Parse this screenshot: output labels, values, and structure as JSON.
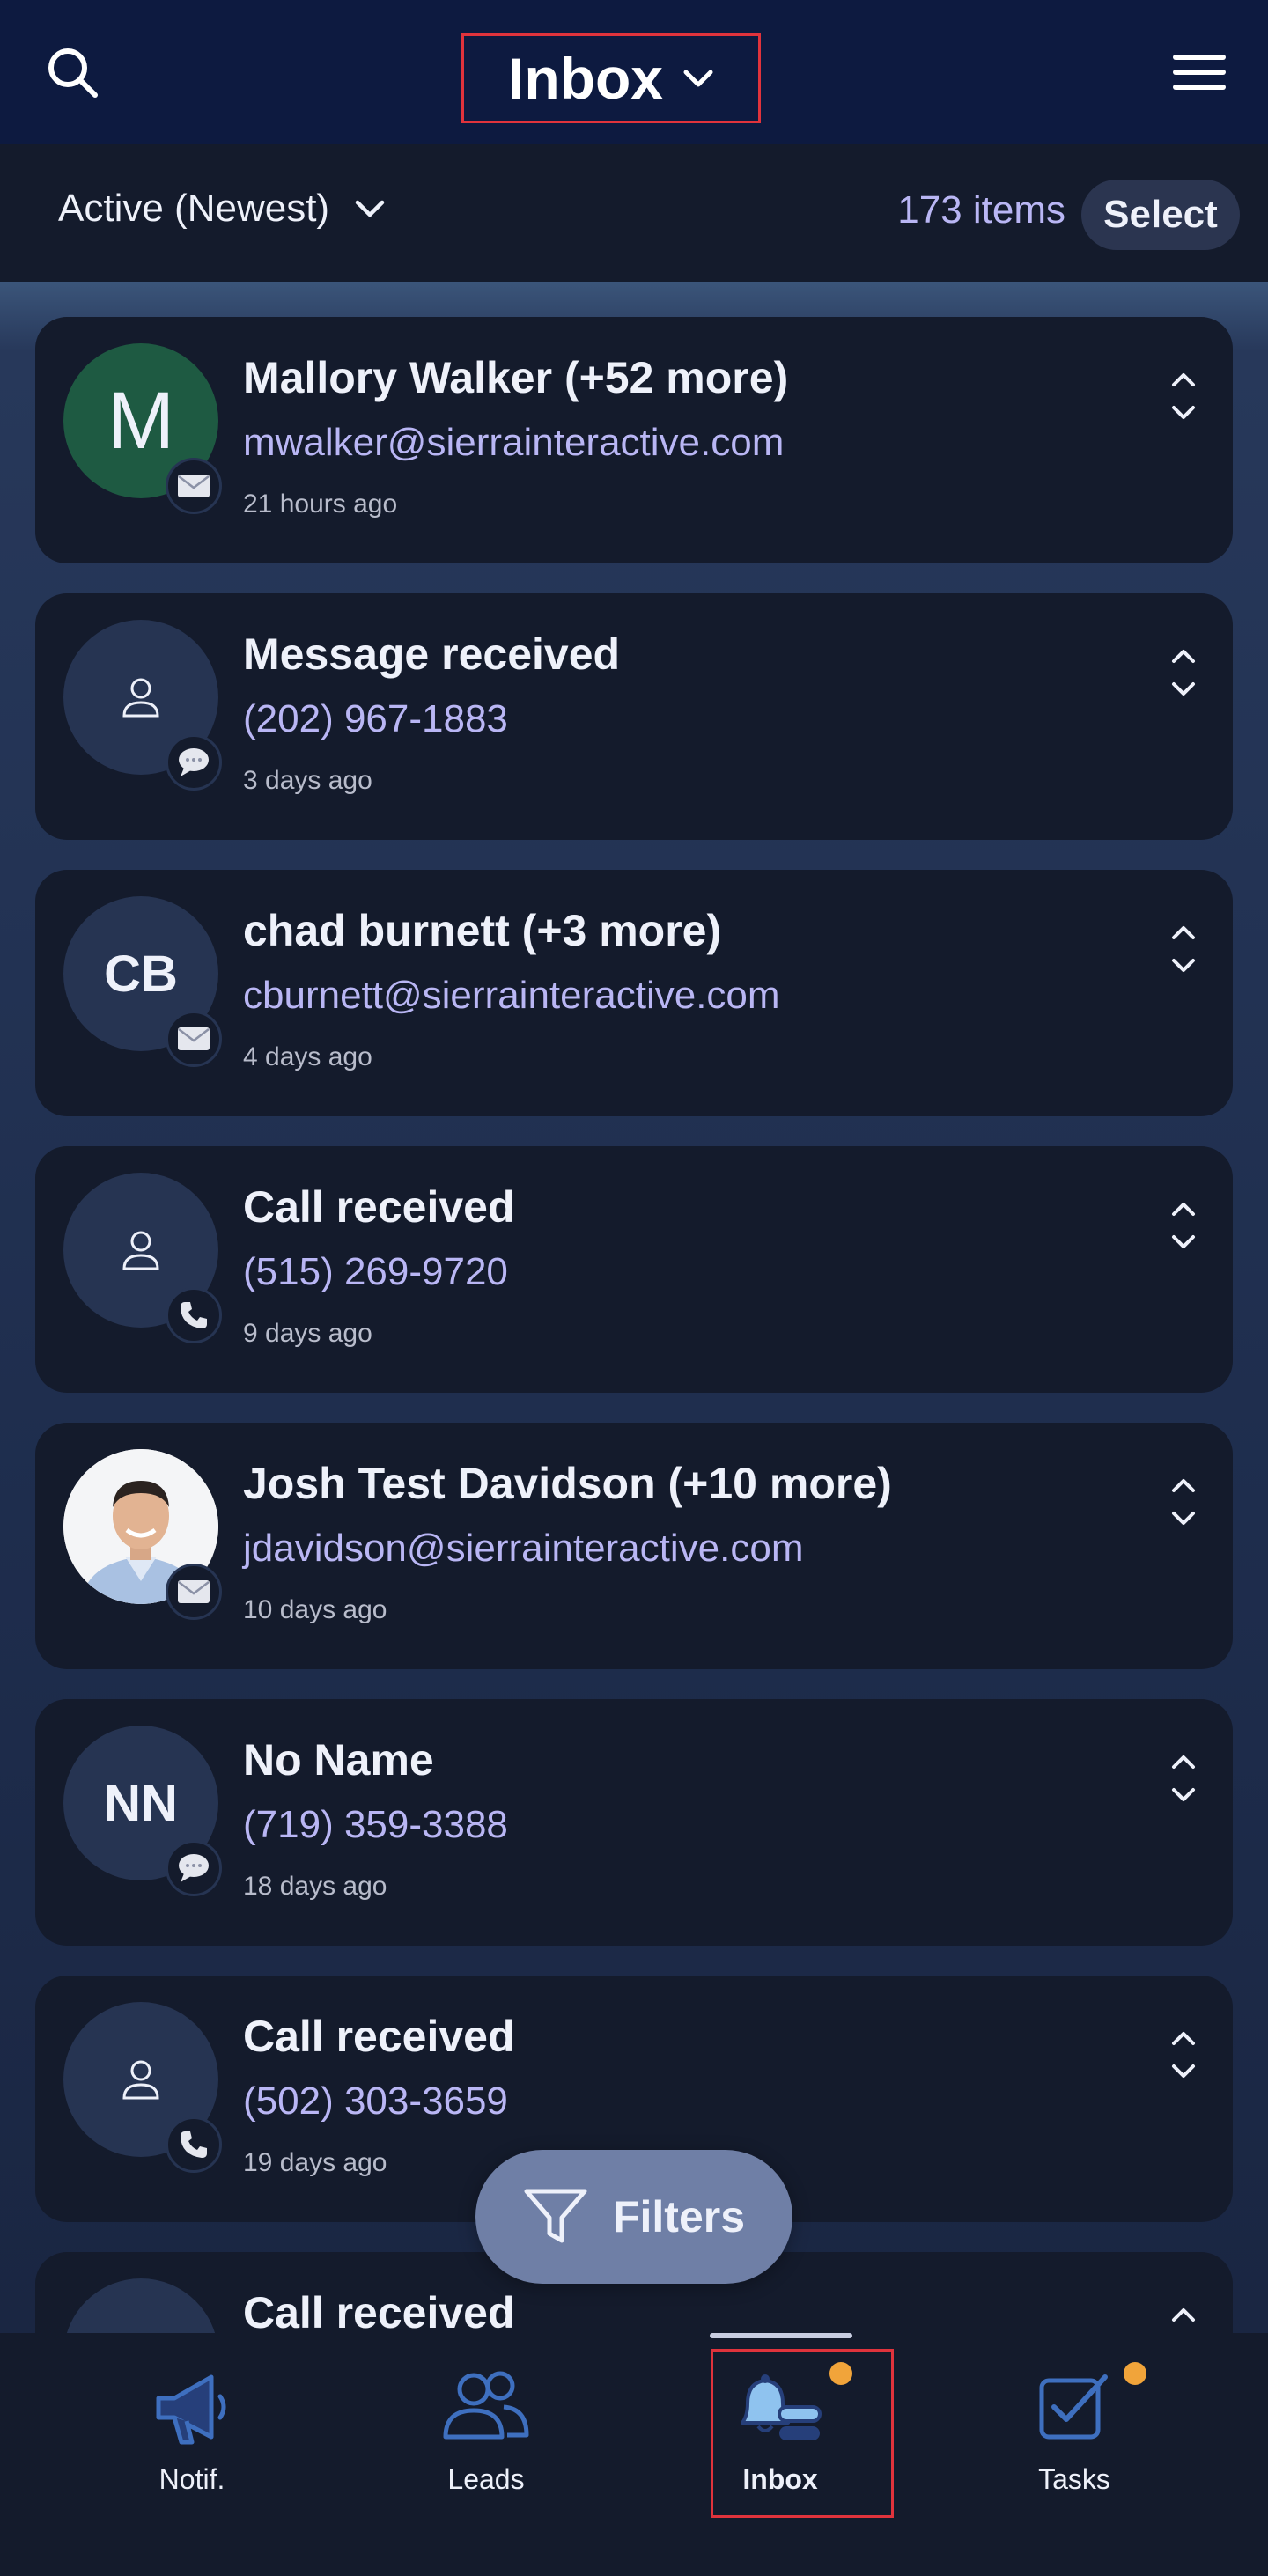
{
  "header": {
    "title": "Inbox"
  },
  "subbar": {
    "sort_label": "Active (Newest)",
    "count": "173 items",
    "select_label": "Select"
  },
  "items": [
    {
      "title": "Mallory Walker (+52 more)",
      "subtitle": "mwalker@sierrainteractive.com",
      "time": "21 hours ago",
      "avatar": "M",
      "channel": "envelope-icon"
    },
    {
      "title": "Message received",
      "subtitle": "(202) 967-1883",
      "time": "3 days ago",
      "avatar": "",
      "channel": "chat-icon"
    },
    {
      "title": "chad burnett (+3 more)",
      "subtitle": "cburnett@sierrainteractive.com",
      "time": "4 days ago",
      "avatar": "CB",
      "channel": "envelope-icon"
    },
    {
      "title": "Call received",
      "subtitle": "(515) 269-9720",
      "time": "9 days ago",
      "avatar": "",
      "channel": "phone-icon"
    },
    {
      "title": "Josh Test Davidson (+10 more)",
      "subtitle": "jdavidson@sierrainteractive.com",
      "time": "10 days ago",
      "avatar": "",
      "channel": "envelope-icon"
    },
    {
      "title": "No Name",
      "subtitle": "(719) 359-3388",
      "time": "18 days ago",
      "avatar": "NN",
      "channel": "chat-icon"
    },
    {
      "title": "Call received",
      "subtitle": "(502) 303-3659",
      "time": "19 days ago",
      "avatar": "",
      "channel": "phone-icon"
    },
    {
      "title": "Call received",
      "subtitle": "",
      "time": "",
      "avatar": "",
      "channel": ""
    }
  ],
  "filters": {
    "label": "Filters"
  },
  "nav": [
    {
      "label": "Notif.",
      "icon": "megaphone-icon"
    },
    {
      "label": "Leads",
      "icon": "users-icon"
    },
    {
      "label": "Inbox",
      "icon": "bell-icon"
    },
    {
      "label": "Tasks",
      "icon": "checkbox-icon"
    }
  ],
  "colors": {
    "accent": "#b9b6f4",
    "highlight": "#e0333c",
    "notification_dot": "#f1a43a",
    "nav_icon": "#3e6fbf"
  }
}
